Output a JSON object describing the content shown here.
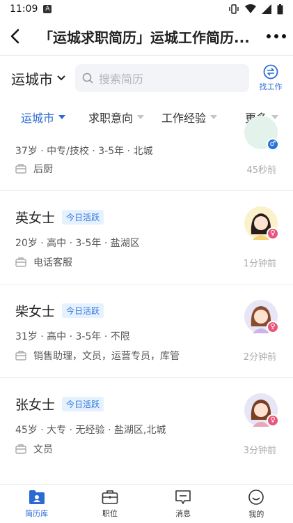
{
  "status": {
    "time": "11:09"
  },
  "header": {
    "title": "「运城求职简历」运城工作简历..."
  },
  "search": {
    "city": "运城市",
    "placeholder": "搜索简历",
    "switch_label": "找工作"
  },
  "filters": {
    "items": [
      "运城市",
      "求职意向",
      "工作经验",
      "更多"
    ],
    "active_index": 0
  },
  "partial_card": {
    "meta": "37岁 · 中专/技校 · 3-5年 · 北城",
    "job": "后厨",
    "time": "45秒前",
    "gender": "male"
  },
  "cards": [
    {
      "name": "英女士",
      "badge": "今日活跃",
      "meta": "20岁 · 高中 · 3-5年 · 盐湖区",
      "job": "电话客服",
      "time": "1分钟前",
      "gender": "female"
    },
    {
      "name": "柴女士",
      "badge": "今日活跃",
      "meta": "31岁 · 高中 · 3-5年 · 不限",
      "job": "销售助理，文员，运营专员，库管",
      "time": "2分钟前",
      "gender": "female"
    },
    {
      "name": "张女士",
      "badge": "今日活跃",
      "meta": "45岁 · 大专 · 无经验 · 盐湖区,北城",
      "job": "文员",
      "time": "3分钟前",
      "gender": "female"
    }
  ],
  "tabbar": {
    "items": [
      "简历库",
      "职位",
      "消息",
      "我的"
    ],
    "active_index": 0
  },
  "colors": {
    "accent": "#2a6ad4",
    "badge_bg": "#e6f1ff",
    "female": "#e9547a",
    "male": "#2a74d8"
  }
}
